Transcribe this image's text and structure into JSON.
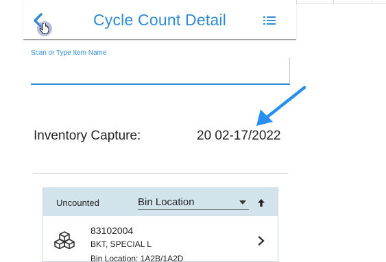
{
  "header": {
    "title": "Cycle Count Detail",
    "back_icon": "chevron-left-icon",
    "menu_icon": "list-icon"
  },
  "scan": {
    "label": "Scan or Type Item Name",
    "value": ""
  },
  "capture": {
    "label": "Inventory Capture:",
    "value": "20 02-17/2022"
  },
  "list": {
    "status": "Uncounted",
    "sort_by": "Bin Location",
    "sort_icon": "arrow-up-icon",
    "items": [
      {
        "item_no": "83102004",
        "description": "BKT, SPECIAL L",
        "bin": "Bin Location: 1A2B/1A2D",
        "icon": "boxes-icon"
      }
    ]
  },
  "colors": {
    "accent": "#2d8bd7",
    "list_header_bg": "#d3e3ec",
    "annotation_arrow": "#2a8ef0"
  }
}
